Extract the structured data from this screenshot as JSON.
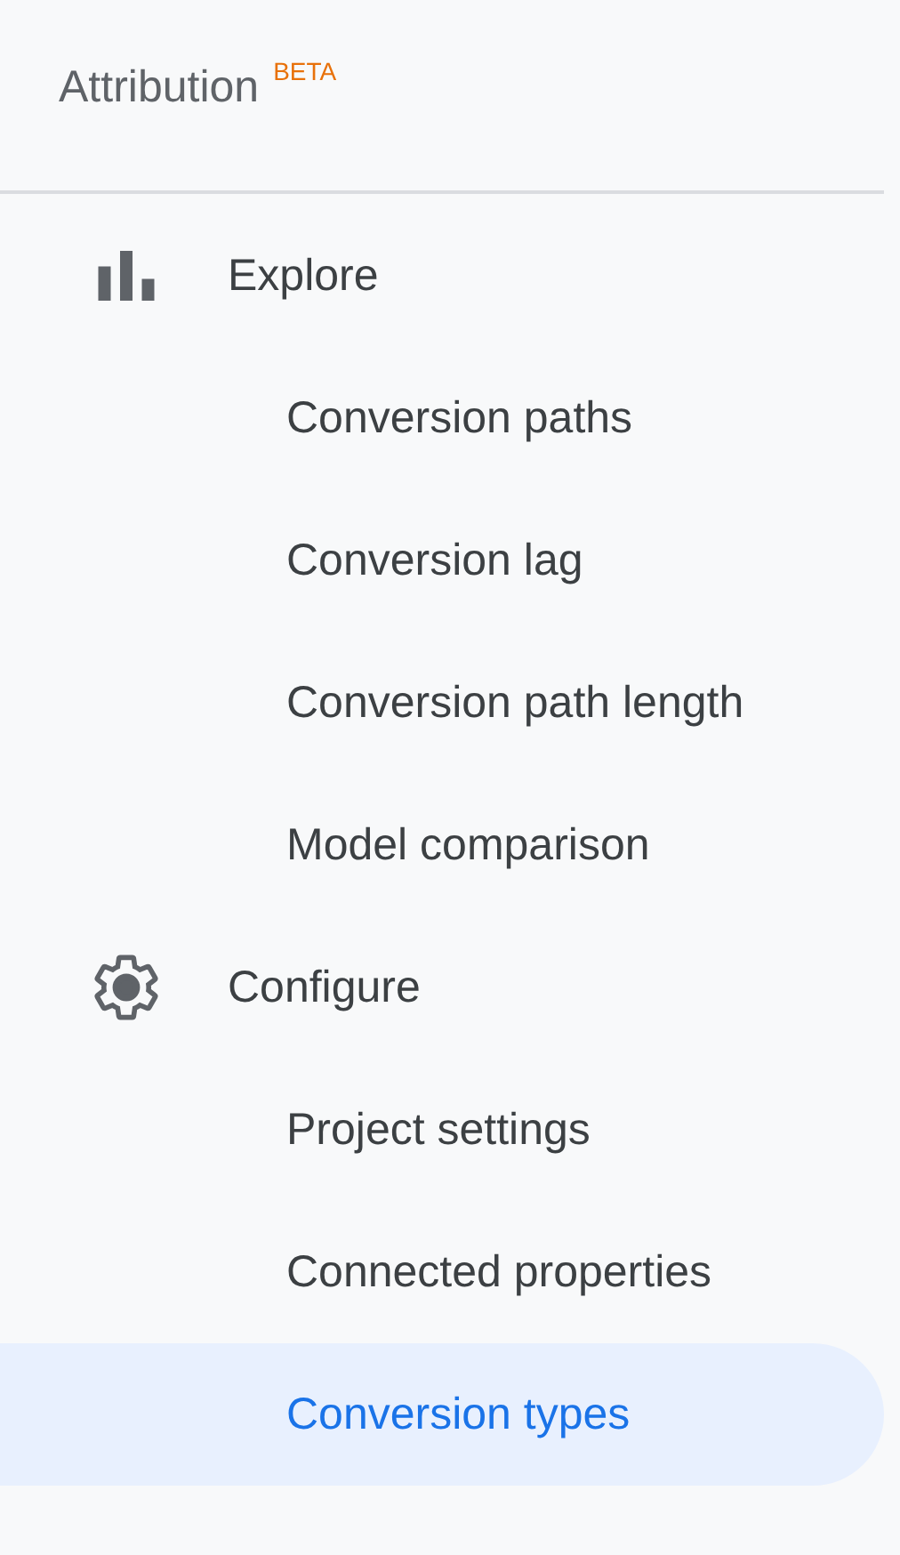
{
  "header": {
    "title": "Attribution",
    "badge": "BETA"
  },
  "nav": [
    {
      "label": "Explore",
      "children": [
        {
          "label": "Conversion paths",
          "selected": false
        },
        {
          "label": "Conversion lag",
          "selected": false
        },
        {
          "label": "Conversion path length",
          "selected": false
        },
        {
          "label": "Model comparison",
          "selected": false
        }
      ]
    },
    {
      "label": "Configure",
      "children": [
        {
          "label": "Project settings",
          "selected": false
        },
        {
          "label": "Connected properties",
          "selected": false
        },
        {
          "label": "Conversion types",
          "selected": true
        }
      ]
    }
  ]
}
